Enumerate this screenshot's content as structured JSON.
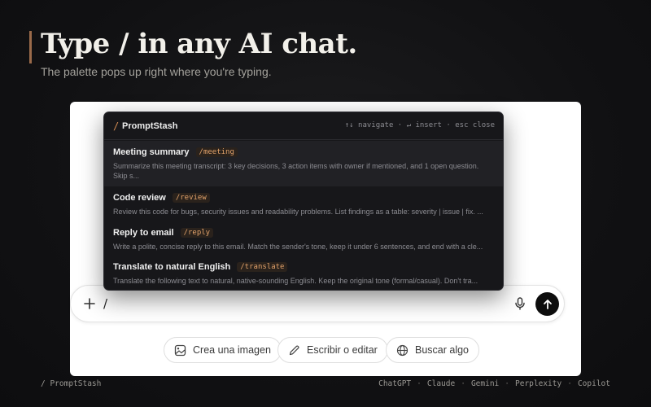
{
  "hero": {
    "title": "Type / in any AI chat.",
    "subtitle": "The palette pops up right where you're typing."
  },
  "palette": {
    "slash": "/",
    "title": "PromptStash",
    "hints": "↑↓ navigate · ↵ insert · esc close",
    "items": [
      {
        "name": "Meeting summary",
        "command": "/meeting",
        "description": "Summarize this meeting transcript: 3 key decisions, 3 action items with owner if mentioned, and 1 open question. Skip s...",
        "active": true
      },
      {
        "name": "Code review",
        "command": "/review",
        "description": "Review this code for bugs, security issues and readability problems. List findings as a table: severity | issue | fix. ...",
        "active": false
      },
      {
        "name": "Reply to email",
        "command": "/reply",
        "description": "Write a polite, concise reply to this email. Match the sender's tone, keep it under 6 sentences, and end with a cle...",
        "active": false
      },
      {
        "name": "Translate to natural English",
        "command": "/translate",
        "description": "Translate the following text to natural, native-sounding English. Keep the original tone (formal/casual). Don't tra...",
        "active": false
      }
    ]
  },
  "input": {
    "value": "/"
  },
  "chips": [
    {
      "label": "Crea una imagen",
      "icon": "image-icon"
    },
    {
      "label": "Escribir o editar",
      "icon": "pencil-icon"
    },
    {
      "label": "Buscar algo",
      "icon": "globe-icon"
    }
  ],
  "footer": {
    "brand": "/ PromptStash",
    "links": [
      "ChatGPT",
      "Claude",
      "Gemini",
      "Perplexity",
      "Copilot"
    ],
    "separator": "·"
  },
  "colors": {
    "accent": "#d08a52",
    "command_tag": "#e3a36b",
    "background": "#111113",
    "palette_bg": "#17171a"
  }
}
